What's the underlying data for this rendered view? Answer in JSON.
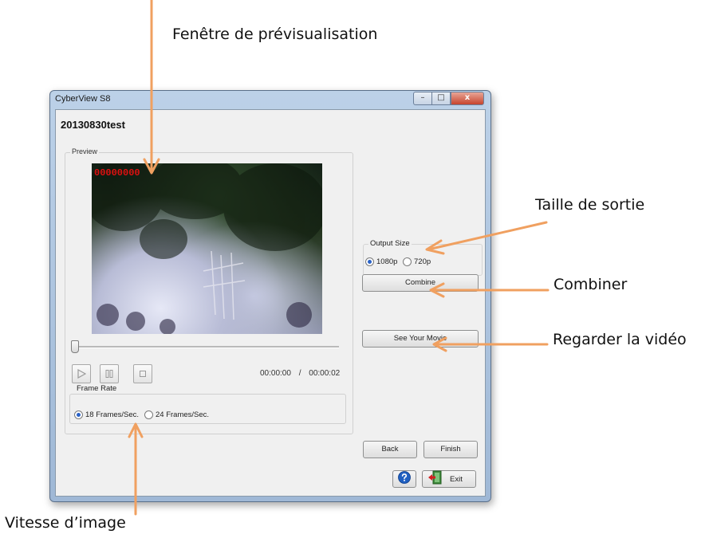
{
  "annotations": {
    "preview_window": "Fenêtre de prévisualisation",
    "output_size": "Taille de sortie",
    "combine": "Combiner",
    "watch_video": "Regarder la vidéo",
    "frame_rate": "Vitesse d’image",
    "arrow_color": "#f0a060"
  },
  "window": {
    "title": "CyberView S8",
    "controls": {
      "minimize": "–",
      "maximize": "□",
      "close": "x"
    }
  },
  "project_title": "20130830test",
  "preview": {
    "group_label": "Preview",
    "frame_counter": "00000000",
    "time_current": "00:00:00",
    "time_separator": "/",
    "time_total": "00:00:02",
    "slider_position": 0
  },
  "frame_rate": {
    "group_label": "Frame Rate",
    "options": [
      "18 Frames/Sec.",
      "24 Frames/Sec."
    ],
    "selected": "18 Frames/Sec."
  },
  "output_size": {
    "group_label": "Output Size",
    "options": [
      "1080p",
      "720p"
    ],
    "selected": "1080p"
  },
  "buttons": {
    "combine": "Combine",
    "see_movie": "See Your Movie",
    "back": "Back",
    "finish": "Finish",
    "exit": "Exit",
    "help_icon": "help-icon",
    "exit_icon": "exit-door-icon"
  },
  "colors": {
    "counter": "#e01010",
    "radio_selected": "#2a62c7",
    "help_blue": "#1f5fc0"
  }
}
